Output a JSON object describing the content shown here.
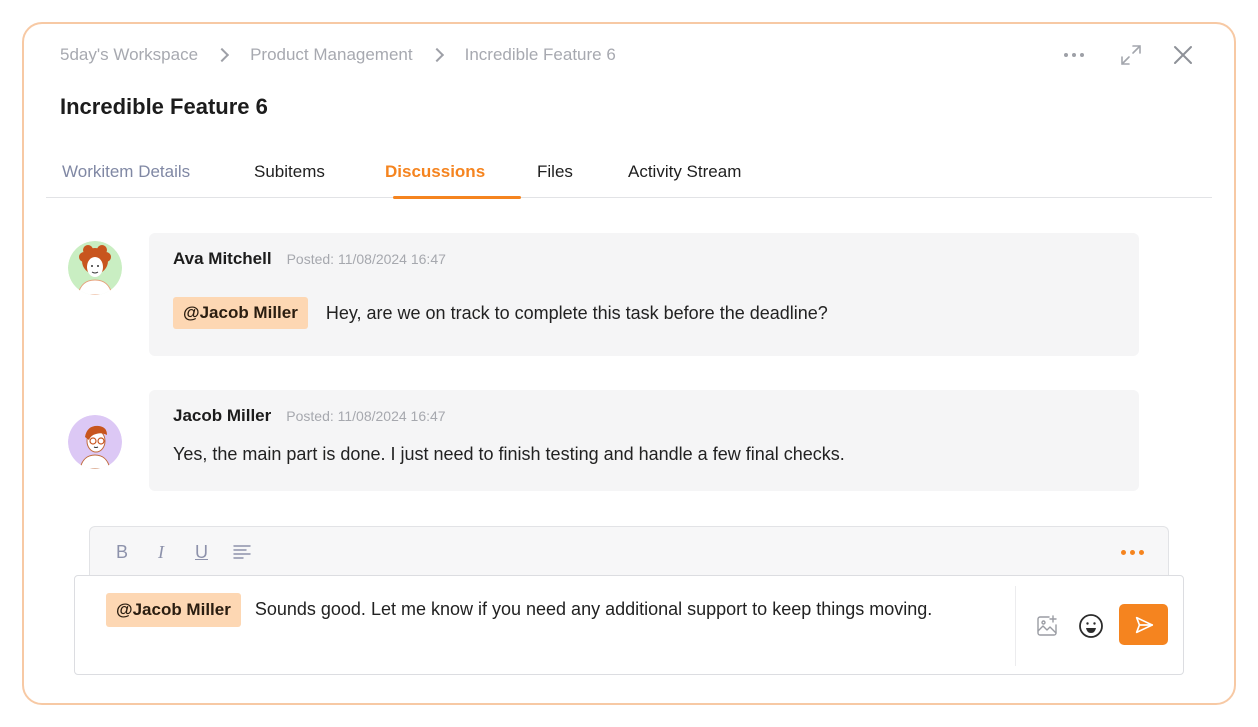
{
  "breadcrumb": [
    "5day's Workspace",
    "Product Management",
    "Incredible Feature 6"
  ],
  "title": "Incredible Feature 6",
  "tabs": [
    {
      "label": "Workitem Details"
    },
    {
      "label": "Subitems"
    },
    {
      "label": "Discussions"
    },
    {
      "label": "Files"
    },
    {
      "label": "Activity Stream"
    }
  ],
  "active_tab": "Discussions",
  "messages": [
    {
      "author": "Ava Mitchell",
      "posted": "Posted: 11/08/2024 16:47",
      "mention": "@Jacob Miller",
      "text": "Hey, are we on track to complete this task before the deadline?"
    },
    {
      "author": "Jacob Miller",
      "posted": "Posted: 11/08/2024 16:47",
      "text": "Yes, the main part is done. I just need to finish testing and handle a few final checks."
    }
  ],
  "toolbar": {
    "bold": "B",
    "italic": "I",
    "underline": "U"
  },
  "composer": {
    "mention": "@Jacob Miller",
    "text": "Sounds good. Let me know if you need any additional support to keep things moving."
  },
  "icons": {
    "more": "more-dots-icon",
    "expand": "expand-icon",
    "close": "close-icon",
    "align": "align-left-icon",
    "attach": "image-add-icon",
    "emoji": "emoji-icon",
    "send": "send-icon"
  },
  "colors": {
    "accent": "#f5841f",
    "panel_border": "#f7c9a4",
    "mention_bg": "#fdd7b3",
    "bubble_bg": "#f5f5f6",
    "muted_text": "#a7a9b0"
  }
}
